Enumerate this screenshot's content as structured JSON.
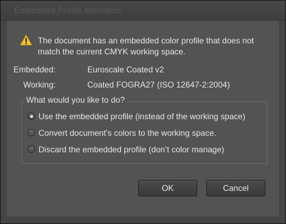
{
  "dialog": {
    "title": "Embedded Profile Mismatch",
    "message": "The document has an embedded color profile that does not match the current CMYK working space.",
    "icon": "warning-icon",
    "embedded_label": "Embedded:",
    "embedded_value": "Euroscale Coated v2",
    "working_label": "Working:",
    "working_value": "Coated FOGRA27 (ISO 12647-2:2004)"
  },
  "options": {
    "legend": "What would you like to do?",
    "items": [
      {
        "label": "Use the embedded profile (instead of the working space)",
        "checked": true
      },
      {
        "label": "Convert document’s colors to the working space.",
        "checked": false
      },
      {
        "label": "Discard the embedded profile (don’t color manage)",
        "checked": false
      }
    ]
  },
  "buttons": {
    "ok": "OK",
    "cancel": "Cancel"
  },
  "colors": {
    "background": "#535353",
    "text": "#e6e6e6",
    "warning": "#f2c230"
  }
}
